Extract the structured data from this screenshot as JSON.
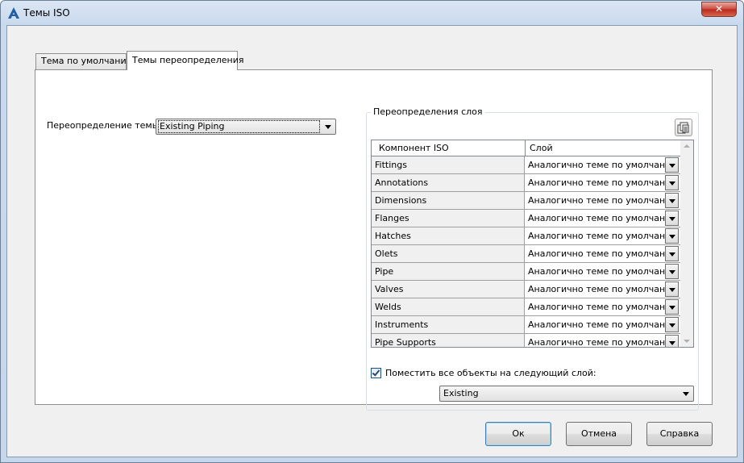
{
  "window": {
    "title": "Темы ISO",
    "close_label": "✕"
  },
  "tabs": [
    {
      "label": "Тема по умолчанию",
      "active": false
    },
    {
      "label": "Темы переопределения",
      "active": true
    }
  ],
  "override": {
    "label": "Переопределение темы:",
    "value": "Existing Piping"
  },
  "layer_group": {
    "title": "Переопределения слоя",
    "columns": [
      "Компонент ISO",
      "Слой"
    ],
    "rows": [
      {
        "component": "Fittings",
        "layer": "Аналогично теме по умолчанию"
      },
      {
        "component": "Annotations",
        "layer": "Аналогично теме по умолчанию"
      },
      {
        "component": "Dimensions",
        "layer": "Аналогично теме по умолчанию"
      },
      {
        "component": "Flanges",
        "layer": "Аналогично теме по умолчанию"
      },
      {
        "component": "Hatches",
        "layer": "Аналогично теме по умолчанию"
      },
      {
        "component": "Olets",
        "layer": "Аналогично теме по умолчанию"
      },
      {
        "component": "Pipe",
        "layer": "Аналогично теме по умолчанию"
      },
      {
        "component": "Valves",
        "layer": "Аналогично теме по умолчанию"
      },
      {
        "component": "Welds",
        "layer": "Аналогично теме по умолчанию"
      },
      {
        "component": "Instruments",
        "layer": "Аналогично теме по умолчанию"
      },
      {
        "component": "Pipe Supports",
        "layer": "Аналогично теме по умолчанию"
      }
    ],
    "place_all": {
      "checked": true,
      "label": "Поместить все объекты на следующий слой:",
      "layer_value": "Existing"
    }
  },
  "buttons": {
    "ok": "Ок",
    "cancel": "Отмена",
    "help": "Справка"
  }
}
